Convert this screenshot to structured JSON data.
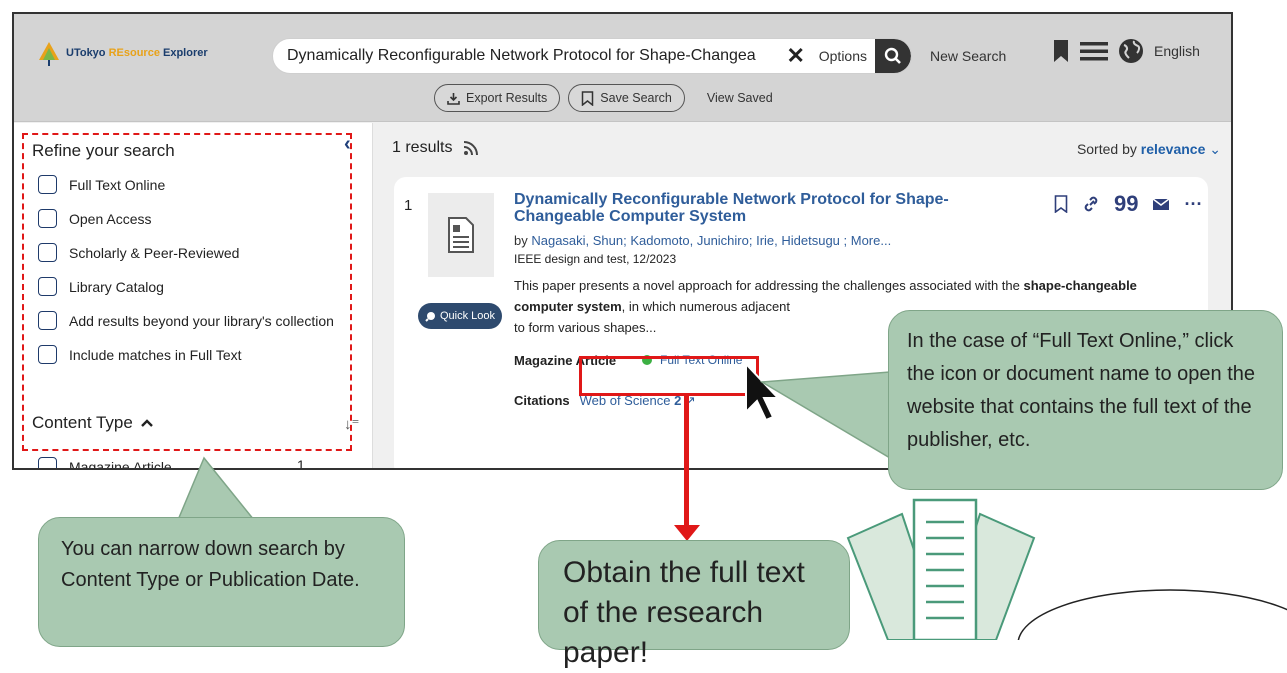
{
  "header": {
    "logo_text_a": "UTokyo ",
    "logo_text_b": "REsource",
    "logo_text_c": " Explorer",
    "search_value": "Dynamically Reconfigurable Network Protocol for Shape-Changea",
    "options_label": "Options",
    "new_search_label": "New Search",
    "language_label": "English",
    "export_label": "Export Results",
    "save_search_label": "Save Search",
    "view_saved_label": "View Saved"
  },
  "sidebar": {
    "title": "Refine your search",
    "filters": [
      {
        "label": "Full Text Online"
      },
      {
        "label": "Open Access"
      },
      {
        "label": "Scholarly & Peer-Reviewed"
      },
      {
        "label": "Library Catalog"
      },
      {
        "label": "Add results beyond your library's collection"
      },
      {
        "label": "Include matches in Full Text"
      }
    ],
    "content_type_title": "Content Type",
    "content_items": [
      {
        "label": "Magazine Article",
        "count": "1"
      }
    ]
  },
  "results": {
    "count_label": "1 results",
    "sorted_prefix": "Sorted by ",
    "sorted_value": "relevance",
    "item": {
      "number": "1",
      "title": "Dynamically Reconfigurable Network Protocol for Shape-Changeable Computer System",
      "by": "by ",
      "authors": "Nagasaki, Shun; Kadomoto, Junichiro; Irie, Hidetsugu ; More...",
      "publication": "IEEE design and test, 12/2023",
      "abstract_a": "This paper presents a novel approach for addressing the challenges associated with the ",
      "abstract_b": "shape-changeable computer system",
      "abstract_c": ", in which numerous adjacent",
      "abstract_d": "to form various shapes...",
      "quick_look": "Quick Look",
      "type": "Magazine Article",
      "full_text": "Full Text Online",
      "citations_label": "Citations",
      "citations_source": "Web of Science",
      "citations_count": "2"
    }
  },
  "callouts": {
    "full_text_note": "In the case of “Full Text Online,” click the icon or document name to open the website that contains the full text of the publisher, etc.",
    "narrow_note": "You can narrow down search by Content Type or Publication Date.",
    "obtain_note": "Obtain the full text of the research paper!"
  },
  "colors": {
    "accent_blue": "#2f5d9a",
    "highlight_red": "#e01818",
    "callout_green": "#a9c9b1",
    "available_dot": "#3cb043"
  }
}
